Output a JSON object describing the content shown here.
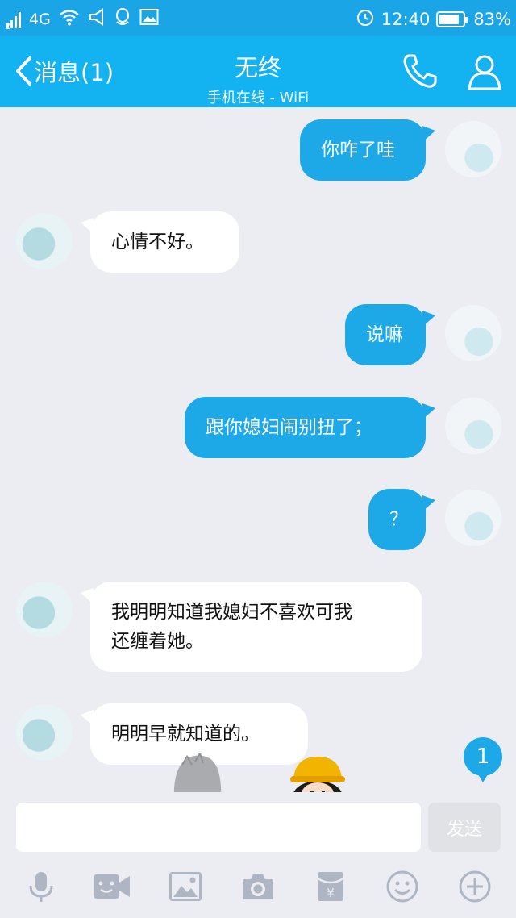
{
  "status_bar": {
    "sim": "2",
    "network": "4G",
    "time": "12:40",
    "battery_percent": "83%",
    "battery_level": 0.83
  },
  "header": {
    "back_label": "消息(1)",
    "contact_name": "无终",
    "contact_status": "手机在线 - WiFi"
  },
  "messages": [
    {
      "from": "me",
      "text": "你咋了哇"
    },
    {
      "from": "other",
      "text": "心情不好。"
    },
    {
      "from": "me",
      "text": "说嘛"
    },
    {
      "from": "me",
      "text": "跟你媳妇闹别扭了；"
    },
    {
      "from": "me",
      "text": "？"
    },
    {
      "from": "other",
      "lines": [
        "我明明知道我媳妇不喜欢可我",
        "还缠着她。"
      ]
    },
    {
      "from": "other",
      "text": "明明早就知道的。"
    }
  ],
  "unread_count": "1",
  "input": {
    "placeholder": "",
    "send_label": "发送"
  },
  "toolbar": [
    "mic-icon",
    "video-icon",
    "image-icon",
    "camera-icon",
    "red-packet-icon",
    "emoji-icon",
    "plus-icon"
  ],
  "colors": {
    "header_bg": "#13b3f1",
    "status_bg": "#1aa6e6",
    "my_bubble": "#1da9e8",
    "their_bubble": "#ffffff",
    "chat_bg": "#ebedf2"
  }
}
